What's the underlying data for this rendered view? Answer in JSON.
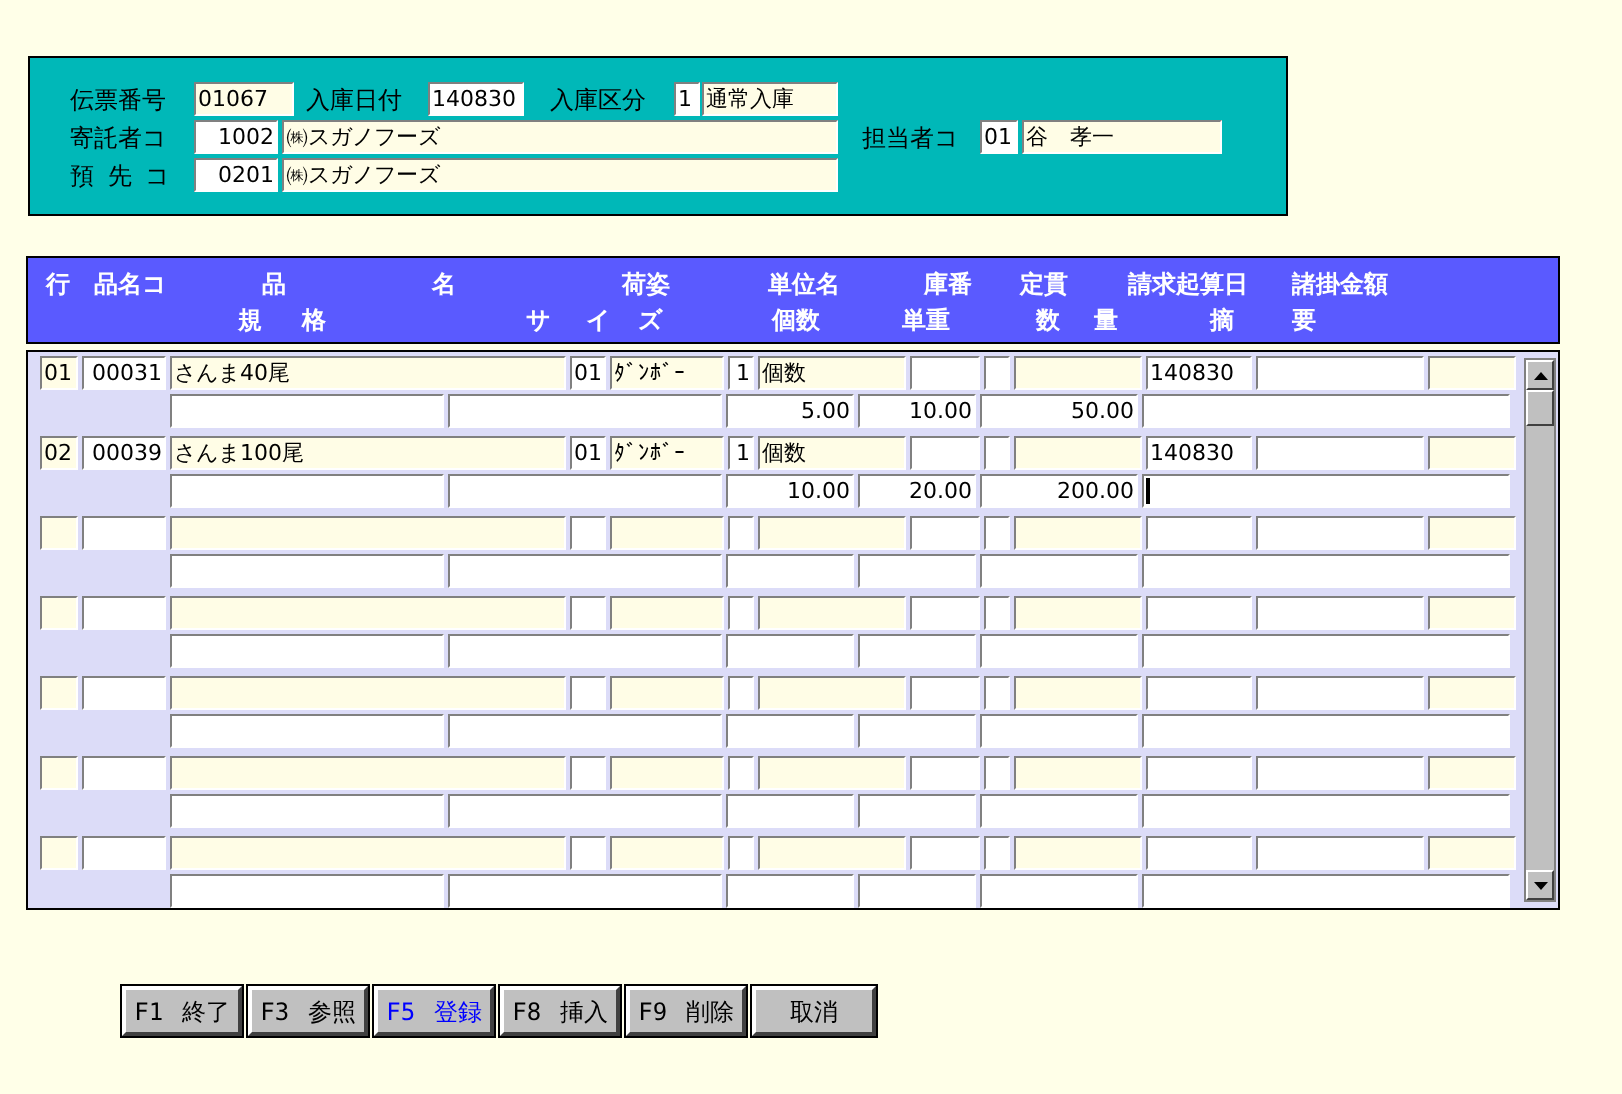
{
  "header_form": {
    "slip_number": {
      "label": "伝票番号",
      "value": "01067"
    },
    "receipt_date": {
      "label": "入庫日付",
      "value": "140830"
    },
    "receipt_type": {
      "label": "入庫区分",
      "code": "1",
      "name": "通常入庫"
    },
    "depositor": {
      "label": "寄託者コ",
      "code": "1002",
      "name": "㈱スガノフーズ"
    },
    "staff": {
      "label": "担当者コ",
      "code": "01",
      "name": "谷　孝一"
    },
    "destination": {
      "label": "預 先 コ",
      "code": "0201",
      "name": "㈱スガノフーズ"
    }
  },
  "grid_header": {
    "line_1": [
      "行",
      "品名コ",
      "品",
      "名",
      "荷姿",
      "単位名",
      "庫番",
      "定貫",
      "請求起算日",
      "諸掛金額"
    ],
    "line_2": [
      "規",
      "格",
      "サ",
      "イ",
      "ズ",
      "個数",
      "単重",
      "数",
      "量",
      "摘",
      "要"
    ]
  },
  "records": [
    {
      "row": "01",
      "product_code": "00031",
      "product_name": "さんま40尾",
      "packing_code": "01",
      "packing": "ﾀﾞﾝﾎﾞｰ",
      "unit_code": "1",
      "unit": "個数",
      "billing_start_date": "140830",
      "quantity": "5.00",
      "unit_weight": "10.00",
      "amount": "50.00",
      "remarks_focused": false
    },
    {
      "row": "02",
      "product_code": "00039",
      "product_name": "さんま100尾",
      "packing_code": "01",
      "packing": "ﾀﾞﾝﾎﾞｰ",
      "unit_code": "1",
      "unit": "個数",
      "billing_start_date": "140830",
      "quantity": "10.00",
      "unit_weight": "20.00",
      "amount": "200.00",
      "remarks_focused": true
    }
  ],
  "function_keys": [
    {
      "label": "F1 終了",
      "selected": false
    },
    {
      "label": "F3 参照",
      "selected": false
    },
    {
      "label": "F5 登録",
      "selected": true
    },
    {
      "label": "F8 挿入",
      "selected": false
    },
    {
      "label": "F9 削除",
      "selected": false
    },
    {
      "label": "取消",
      "selected": false
    }
  ]
}
